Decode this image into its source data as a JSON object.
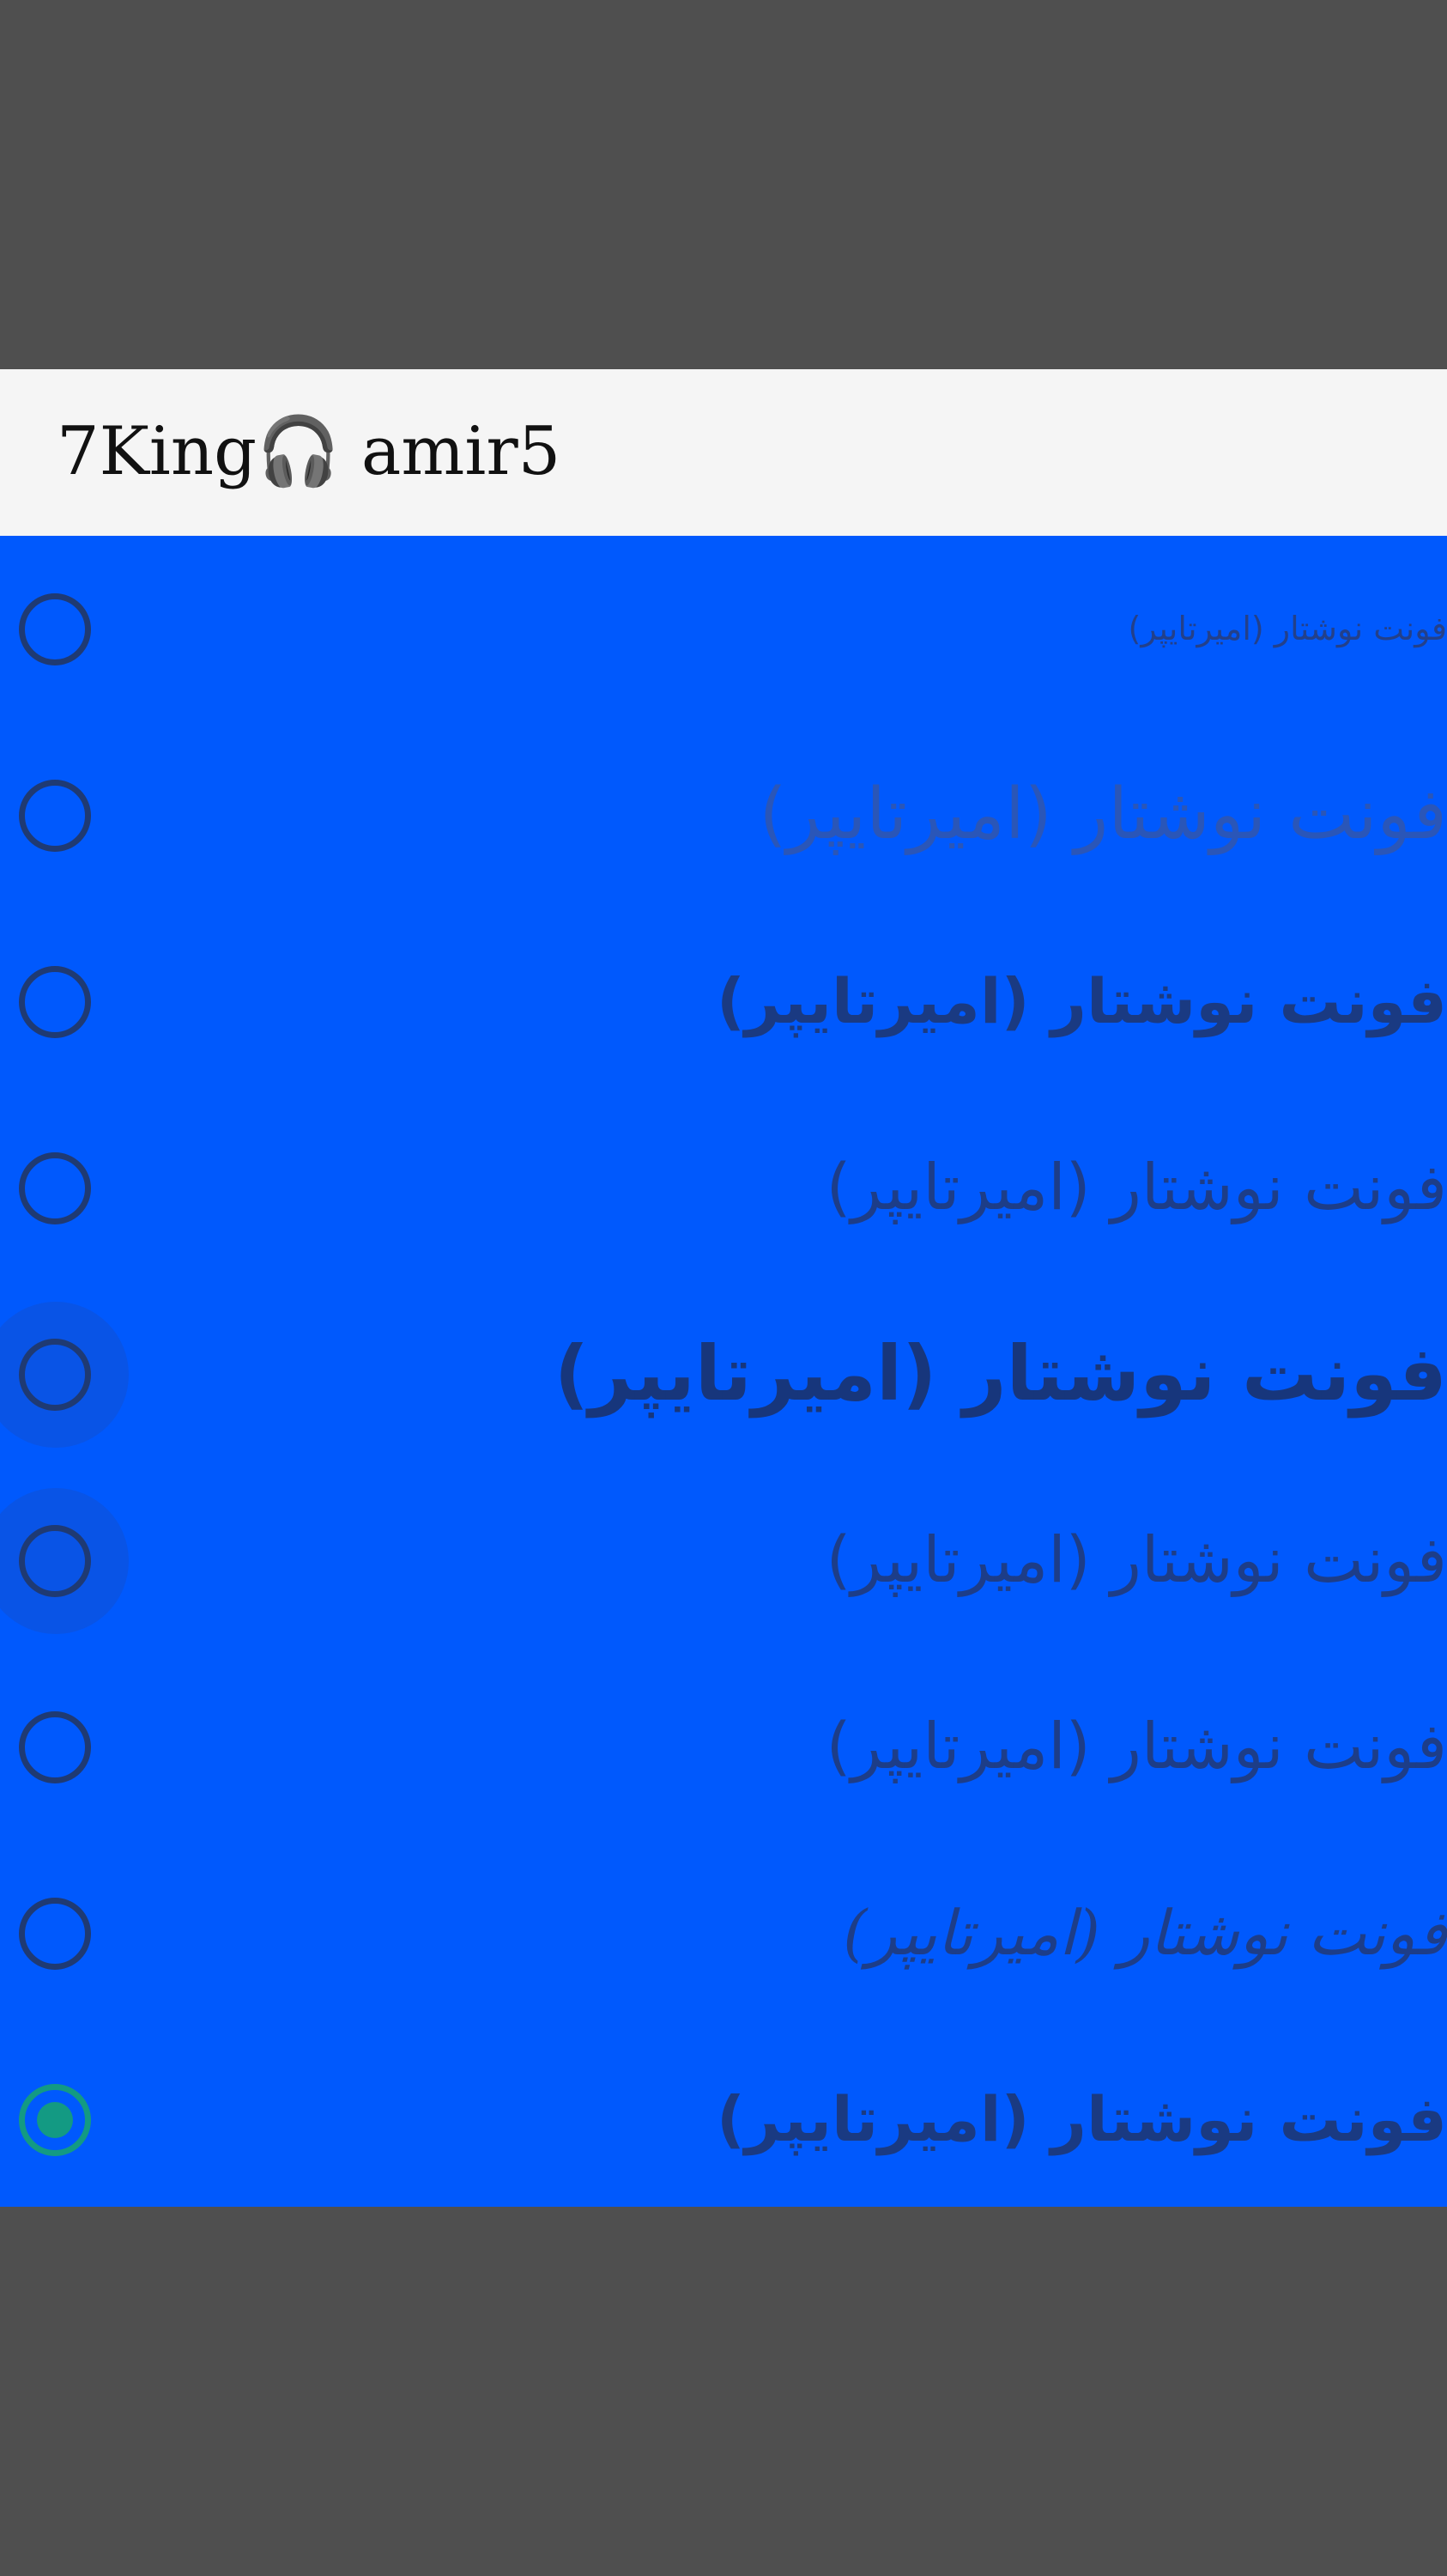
{
  "dialog": {
    "title": "7King🎧 amir5"
  },
  "options": [
    {
      "label": "فونت نوشتار (امیرتایپر)",
      "selected": false
    },
    {
      "label": "فونت نوشتار (امیرتایپر)",
      "selected": false
    },
    {
      "label": "فونت نوشتار (امیرتایپر)",
      "selected": false
    },
    {
      "label": "فونت نوشتار (امیرتایپر)",
      "selected": false
    },
    {
      "label": "فونت نوشتار (امیرتایپر)",
      "selected": false
    },
    {
      "label": "فونت نوشتار (امیرتایپر)",
      "selected": false
    },
    {
      "label": "فونت نوشتار (امیرتایپر)",
      "selected": false
    },
    {
      "label": "فونت نوشتار (امیرتایپر)",
      "selected": false
    },
    {
      "label": "فونت نوشتار (امیرتایپر)",
      "selected": true
    }
  ],
  "colors": {
    "backdrop": "#4f4f4f",
    "dialog_background": "#0059fd",
    "header_background": "#f5f5f5",
    "radio_unchecked": "#1f3a73",
    "radio_checked": "#139a83"
  }
}
